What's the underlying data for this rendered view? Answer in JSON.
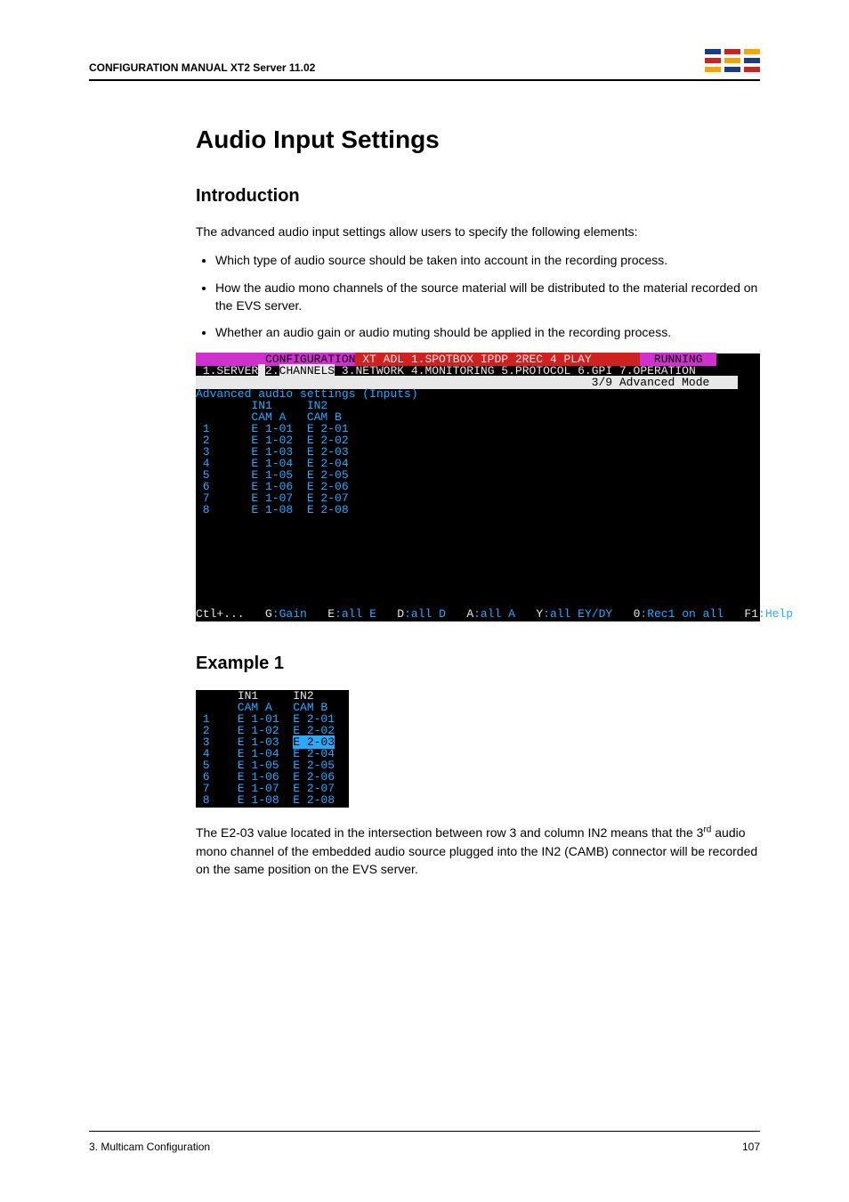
{
  "header": {
    "title": "CONFIGURATION MANUAL   XT2 Server 11.02"
  },
  "h1": "Audio Input Settings",
  "intro": {
    "heading": "Introduction",
    "lead": "The advanced audio input settings allow users to specify the following elements:",
    "bullets": [
      "Which type of audio source should be taken into account in the recording process.",
      "How the audio mono channels of the source material will be distributed to the material recorded on the EVS server.",
      "Whether an audio gain or audio muting should be applied in the recording process."
    ]
  },
  "terminal1": {
    "title_left": "CONFIGURATION",
    "title_center": "XT ADL 1.SPOTBOX IPDP 2REC 4 PLAY",
    "title_right": "RUNNING",
    "menu": [
      "1.SERVER",
      "2.CHANNELS",
      "3.NETWORK",
      "4.MONITORING",
      "5.PROTOCOL",
      "6.GPI",
      "7.OPERATION"
    ],
    "mode": "3/9 Advanced Mode",
    "section": "Advanced audio settings (Inputs)",
    "cols": [
      "IN1",
      "IN2"
    ],
    "cams": [
      "CAM A",
      "CAM B"
    ],
    "rows": [
      {
        "n": "1",
        "in1": "E 1-01",
        "in2": "E 2-01"
      },
      {
        "n": "2",
        "in1": "E 1-02",
        "in2": "E 2-02"
      },
      {
        "n": "3",
        "in1": "E 1-03",
        "in2": "E 2-03"
      },
      {
        "n": "4",
        "in1": "E 1-04",
        "in2": "E 2-04"
      },
      {
        "n": "5",
        "in1": "E 1-05",
        "in2": "E 2-05"
      },
      {
        "n": "6",
        "in1": "E 1-06",
        "in2": "E 2-06"
      },
      {
        "n": "7",
        "in1": "E 1-07",
        "in2": "E 2-07"
      },
      {
        "n": "8",
        "in1": "E 1-08",
        "in2": "E 2-08"
      }
    ],
    "footer": {
      "ctl": "Ctl+...",
      "g": "G:Gain",
      "e": "E:all E",
      "d": "D:all D",
      "a": "A:all A",
      "y": "Y:all EY/DY",
      "zero": "0:Rec1 on all",
      "f1": "F1:Help"
    }
  },
  "example": {
    "heading": "Example 1",
    "cols": [
      "IN1",
      "IN2"
    ],
    "cams": [
      "CAM A",
      "CAM B"
    ],
    "rows": [
      {
        "n": "1",
        "in1": "E 1-01",
        "in2": "E 2-01"
      },
      {
        "n": "2",
        "in1": "E 1-02",
        "in2": "E 2-02"
      },
      {
        "n": "3",
        "in1": "E 1-03",
        "in2": "E 2-03"
      },
      {
        "n": "4",
        "in1": "E 1-04",
        "in2": "E 2-04"
      },
      {
        "n": "5",
        "in1": "E 1-05",
        "in2": "E 2-05"
      },
      {
        "n": "6",
        "in1": "E 1-06",
        "in2": "E 2-06"
      },
      {
        "n": "7",
        "in1": "E 1-07",
        "in2": "E 2-07"
      },
      {
        "n": "8",
        "in1": "E 1-08",
        "in2": "E 2-08"
      }
    ],
    "para_a": "The E2-03 value located in the intersection between row 3 and column IN2 means that the 3",
    "para_sup": "rd",
    "para_b": " audio mono channel of the embedded audio source plugged into the IN2 (CAMB) connector will be recorded on the same position on the EVS server."
  },
  "footer": {
    "left": "3. Multicam Configuration",
    "right": "107"
  }
}
